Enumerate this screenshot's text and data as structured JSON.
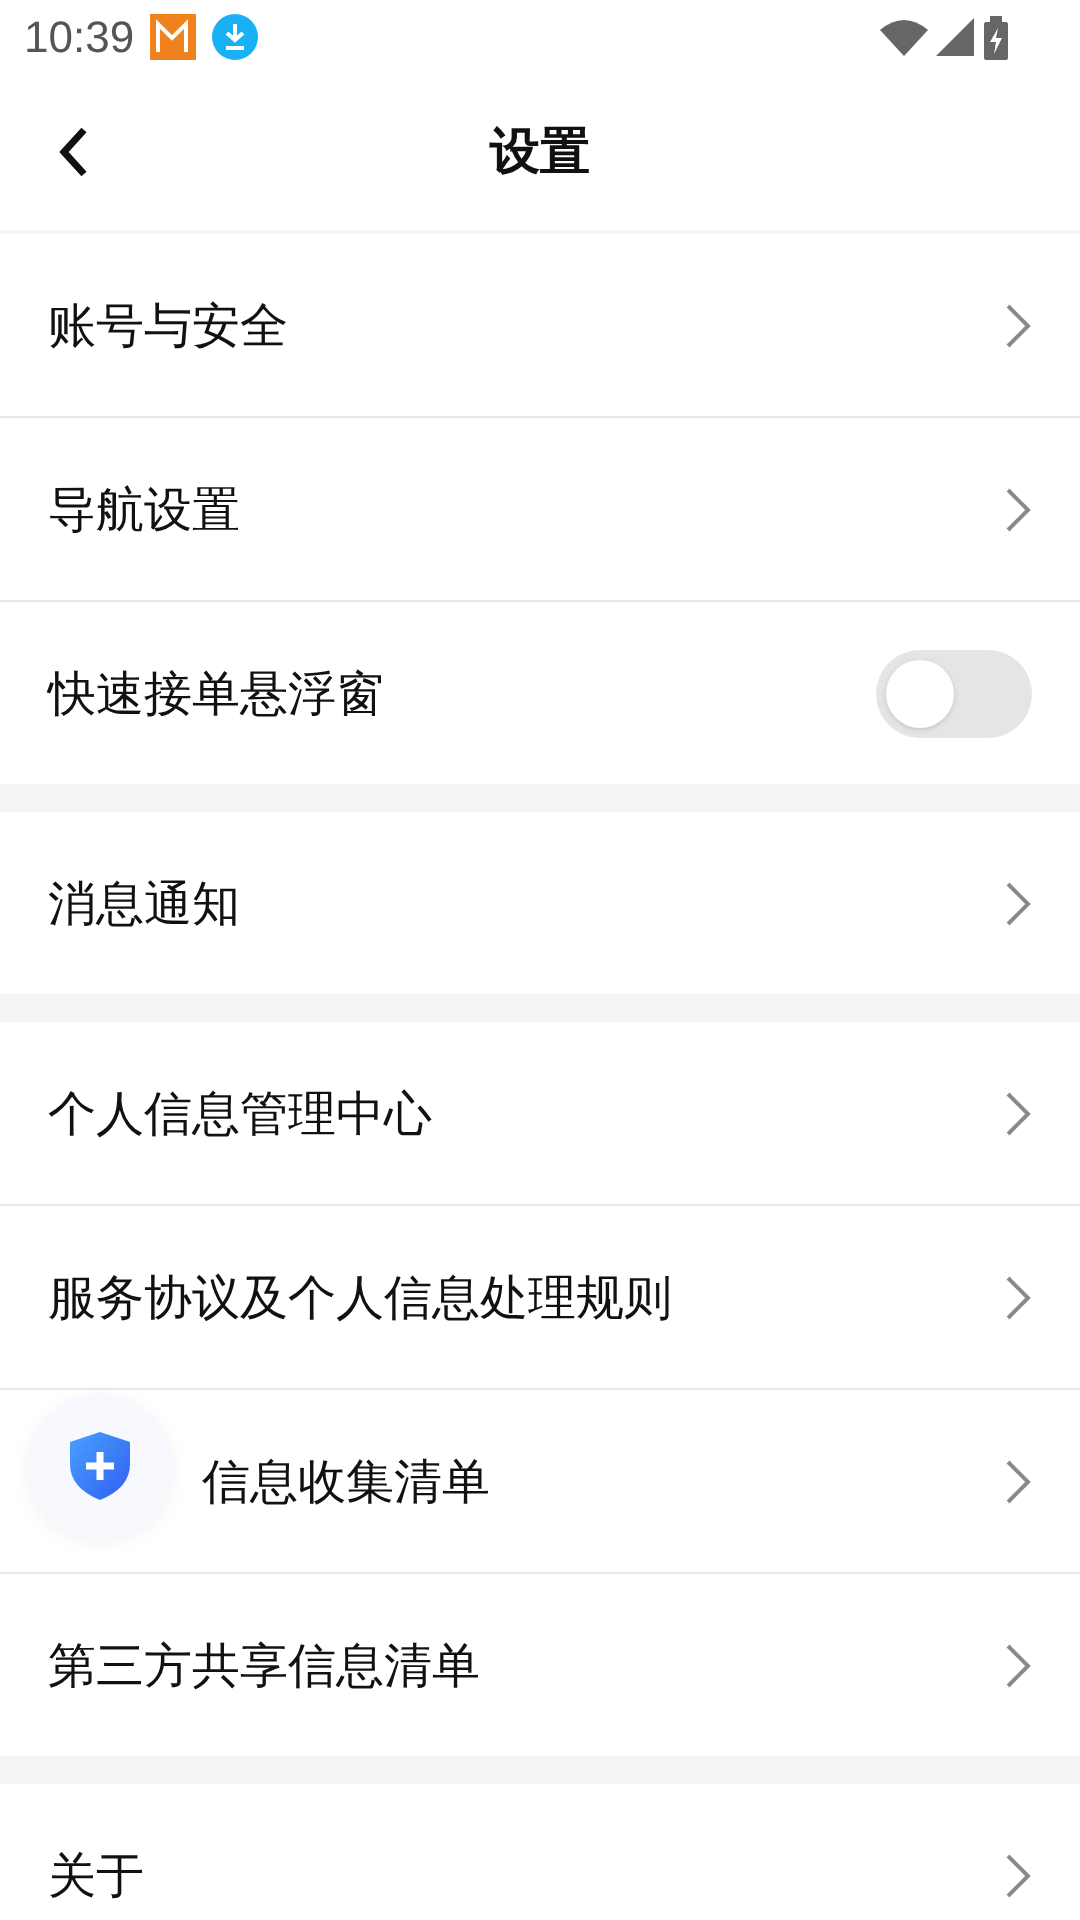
{
  "status_bar": {
    "time": "10:39"
  },
  "header": {
    "title": "设置"
  },
  "groups": [
    {
      "items": [
        {
          "kind": "link",
          "label": "账号与安全"
        },
        {
          "kind": "link",
          "label": "导航设置"
        },
        {
          "kind": "toggle",
          "label": "快速接单悬浮窗",
          "on": false
        }
      ]
    },
    {
      "items": [
        {
          "kind": "link",
          "label": "消息通知"
        }
      ]
    },
    {
      "items": [
        {
          "kind": "link",
          "label": "个人信息管理中心"
        },
        {
          "kind": "link",
          "label": "服务协议及个人信息处理规则"
        },
        {
          "kind": "covered_link",
          "label": "信息收集清单"
        },
        {
          "kind": "link",
          "label": "第三方共享信息清单"
        }
      ]
    },
    {
      "items": [
        {
          "kind": "link",
          "label": "关于"
        }
      ]
    }
  ]
}
